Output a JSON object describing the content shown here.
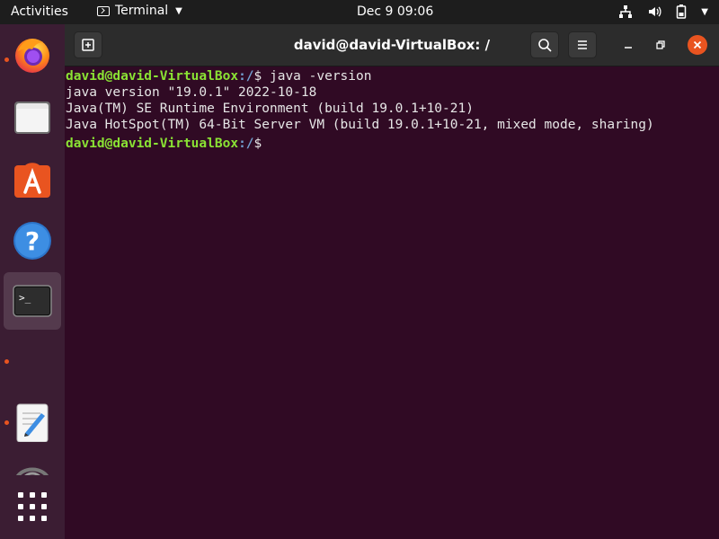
{
  "topbar": {
    "activities": "Activities",
    "app_name": "Terminal",
    "clock": "Dec 9  09:06",
    "icons": [
      "network-icon",
      "volume-icon",
      "battery-icon",
      "power-menu-icon"
    ]
  },
  "dock": {
    "items": [
      {
        "name": "firefox",
        "running": true
      },
      {
        "name": "files",
        "running": false
      },
      {
        "name": "ubuntu-software",
        "running": false
      },
      {
        "name": "help",
        "running": false
      },
      {
        "name": "terminal",
        "running": true,
        "active": true
      },
      {
        "name": "text-editor",
        "running": true
      },
      {
        "name": "show-applications",
        "running": false
      }
    ]
  },
  "window": {
    "title": "david@david-VirtualBox: /",
    "lines": [
      {
        "user": "david@david-VirtualBox",
        "path": ":/",
        "cmd": "$ java -version"
      },
      {
        "text": "java version \"19.0.1\" 2022-10-18"
      },
      {
        "text": "Java(TM) SE Runtime Environment (build 19.0.1+10-21)"
      },
      {
        "text": "Java HotSpot(TM) 64-Bit Server VM (build 19.0.1+10-21, mixed mode, sharing)"
      },
      {
        "user": "david@david-VirtualBox",
        "path": ":/",
        "cmd": "$ "
      }
    ]
  },
  "colors": {
    "terminal_bg": "#300a24",
    "prompt_user": "#8ae234",
    "prompt_path": "#729fcf",
    "close_button": "#e95420"
  }
}
